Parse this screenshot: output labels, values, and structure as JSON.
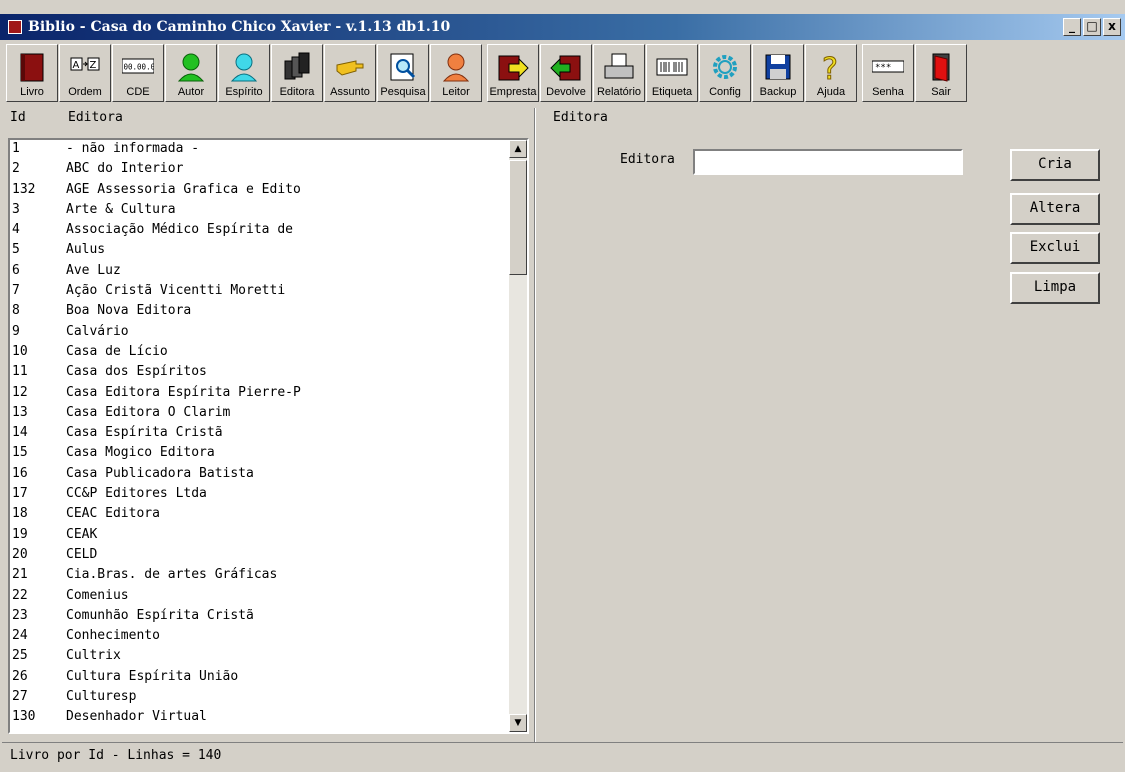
{
  "window": {
    "title": "Biblio - Casa do Caminho Chico Xavier - v.1.13 db1.10",
    "controls": [
      "_",
      "□",
      "x"
    ]
  },
  "toolbar": [
    {
      "label": "Livro",
      "icon": "book-icon"
    },
    {
      "label": "Ordem",
      "icon": "sort-az-icon"
    },
    {
      "label": "CDE",
      "icon": "cde-code-icon",
      "code": "00.00.00"
    },
    {
      "label": "Autor",
      "icon": "author-person-icon"
    },
    {
      "label": "Espírito",
      "icon": "spirit-person-icon"
    },
    {
      "label": "Editora",
      "icon": "publisher-books-icon"
    },
    {
      "label": "Assunto",
      "icon": "subject-hand-icon"
    },
    {
      "label": "Pesquisa",
      "icon": "search-magnifier-icon"
    },
    {
      "label": "Leitor",
      "icon": "reader-person-icon"
    },
    {
      "label": "Empresta",
      "icon": "lend-arrow-icon"
    },
    {
      "label": "Devolve",
      "icon": "return-arrow-icon"
    },
    {
      "label": "Relatório",
      "icon": "report-printer-icon"
    },
    {
      "label": "Etiqueta",
      "icon": "label-barcode-icon"
    },
    {
      "label": "Config",
      "icon": "config-gear-icon"
    },
    {
      "label": "Backup",
      "icon": "backup-floppy-icon"
    },
    {
      "label": "Ajuda",
      "icon": "help-question-icon"
    },
    {
      "label": "Senha",
      "icon": "password-field-icon",
      "code": "***"
    },
    {
      "label": "Sair",
      "icon": "exit-door-icon"
    }
  ],
  "list": {
    "col_id": "Id",
    "col_name": "Editora",
    "rows": [
      {
        "id": "1",
        "name": "- não informada -"
      },
      {
        "id": "2",
        "name": "ABC do Interior"
      },
      {
        "id": "132",
        "name": "AGE Assessoria Grafica e Edito"
      },
      {
        "id": "3",
        "name": "Arte & Cultura"
      },
      {
        "id": "4",
        "name": "Associação Médico Espírita de"
      },
      {
        "id": "5",
        "name": "Aulus"
      },
      {
        "id": "6",
        "name": "Ave Luz"
      },
      {
        "id": "7",
        "name": "Ação Cristã Vicentti Moretti"
      },
      {
        "id": "8",
        "name": "Boa Nova Editora"
      },
      {
        "id": "9",
        "name": "Calvário"
      },
      {
        "id": "10",
        "name": "Casa de Lício"
      },
      {
        "id": "11",
        "name": "Casa dos Espíritos"
      },
      {
        "id": "12",
        "name": "Casa Editora Espírita Pierre-P"
      },
      {
        "id": "13",
        "name": "Casa Editora O Clarim"
      },
      {
        "id": "14",
        "name": "Casa Espírita Cristã"
      },
      {
        "id": "15",
        "name": "Casa Mogico Editora"
      },
      {
        "id": "16",
        "name": "Casa Publicadora Batista"
      },
      {
        "id": "17",
        "name": "CC&P Editores Ltda"
      },
      {
        "id": "18",
        "name": "CEAC Editora"
      },
      {
        "id": "19",
        "name": "CEAK"
      },
      {
        "id": "20",
        "name": "CELD"
      },
      {
        "id": "21",
        "name": "Cia.Bras. de artes Gráficas"
      },
      {
        "id": "22",
        "name": "Comenius"
      },
      {
        "id": "23",
        "name": "Comunhão Espírita Cristã"
      },
      {
        "id": "24",
        "name": "Conhecimento"
      },
      {
        "id": "25",
        "name": "Cultrix"
      },
      {
        "id": "26",
        "name": "Cultura Espírita União"
      },
      {
        "id": "27",
        "name": "Culturesp"
      },
      {
        "id": "130",
        "name": "Desenhador Virtual"
      }
    ]
  },
  "form": {
    "section_title": "Editora",
    "field_label": "Editora",
    "field_value": "",
    "buttons": {
      "create": "Cria",
      "alter": "Altera",
      "delete": "Exclui",
      "clear": "Limpa"
    }
  },
  "status": "Livro por Id - Linhas = 140"
}
